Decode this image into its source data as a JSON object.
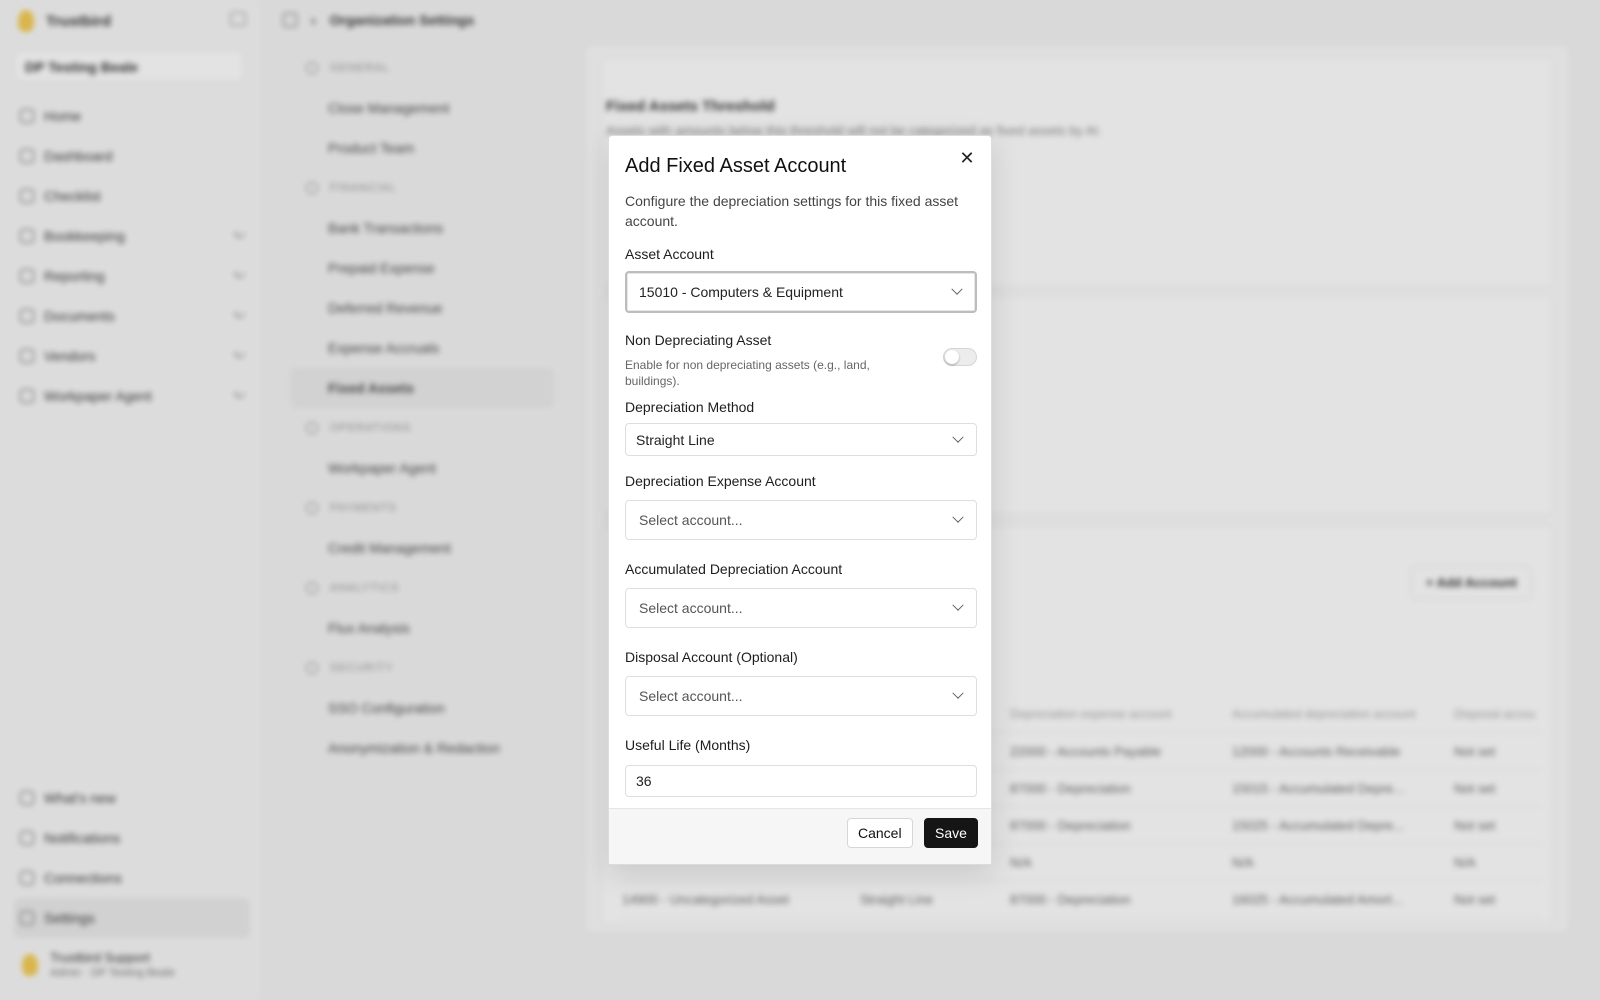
{
  "app": {
    "brand": "Trustbird",
    "org": "DP Testing Beale",
    "breadcrumb": "Organization Settings"
  },
  "sidebar": {
    "items": [
      {
        "label": "Home"
      },
      {
        "label": "Dashboard"
      },
      {
        "label": "Checklist"
      },
      {
        "label": "Bookkeeping"
      },
      {
        "label": "Reporting"
      },
      {
        "label": "Documents"
      },
      {
        "label": "Vendors"
      },
      {
        "label": "Workpaper Agent"
      }
    ],
    "bottom": [
      {
        "label": "What's new"
      },
      {
        "label": "Notifications"
      },
      {
        "label": "Connections"
      },
      {
        "label": "Settings"
      }
    ],
    "user": {
      "name": "Trustbird Support",
      "role": "Admin · DP Testing Beale"
    }
  },
  "settings_nav": {
    "general": "GENERAL",
    "close_management": "Close Management",
    "product_team": "Product Team",
    "financial": "FINANCIAL",
    "bank_transactions": "Bank Transactions",
    "prepaid_expense": "Prepaid Expense",
    "deferred_revenue": "Deferred Revenue",
    "expense_accruals": "Expense Accruals",
    "fixed_assets": "Fixed Assets",
    "operations": "OPERATIONS",
    "workpaper_agent": "Workpaper Agent",
    "payments": "PAYMENTS",
    "credit_management": "Credit Management",
    "analytics": "ANALYTICS",
    "flux_analysis": "Flux Analysis",
    "security": "SECURITY",
    "sso_configuration": "SSO Configuration",
    "anonymization": "Anonymization & Redaction"
  },
  "content": {
    "threshold_title": "Fixed Assets Threshold",
    "threshold_desc": "Assets with amounts below this threshold will not be categorized as fixed assets by AI.",
    "add_account": "Add Account",
    "table_headers": [
      "Depreciation expense account",
      "Accumulated depreciation account",
      "Disposal accou"
    ],
    "rows": [
      [
        "22000 - Accounts Payable",
        "12000 - Accounts Receivable",
        "Not set"
      ],
      [
        "87000 - Depreciation",
        "15015 - Accumulated Depre...",
        "Not set"
      ],
      [
        "87000 - Depreciation",
        "15025 - Accumulated Depre...",
        "Not set"
      ],
      [
        "N/A",
        "N/A",
        "N/A"
      ],
      [
        "87000 - Depreciation",
        "16025 - Accumulated Amort...",
        "Not set"
      ]
    ],
    "last_row_account": "14900 - Uncategorized Asset",
    "last_row_method": "Straight Line"
  },
  "modal": {
    "title": "Add Fixed Asset Account",
    "description": "Configure the depreciation settings for this fixed asset account.",
    "asset_account_label": "Asset Account",
    "asset_account_value": "15010 - Computers & Equipment",
    "non_depreciating_label": "Non Depreciating Asset",
    "non_depreciating_hint": "Enable for non depreciating assets (e.g., land, buildings).",
    "non_depreciating_enabled": false,
    "method_label": "Depreciation Method",
    "method_value": "Straight Line",
    "expense_label": "Depreciation Expense Account",
    "expense_placeholder": "Select account...",
    "accumulated_label": "Accumulated Depreciation Account",
    "accumulated_placeholder": "Select account...",
    "disposal_label": "Disposal Account (Optional)",
    "disposal_placeholder": "Select account...",
    "useful_life_label": "Useful Life (Months)",
    "useful_life_value": "36",
    "cancel": "Cancel",
    "save": "Save",
    "close_glyph": "✕"
  }
}
